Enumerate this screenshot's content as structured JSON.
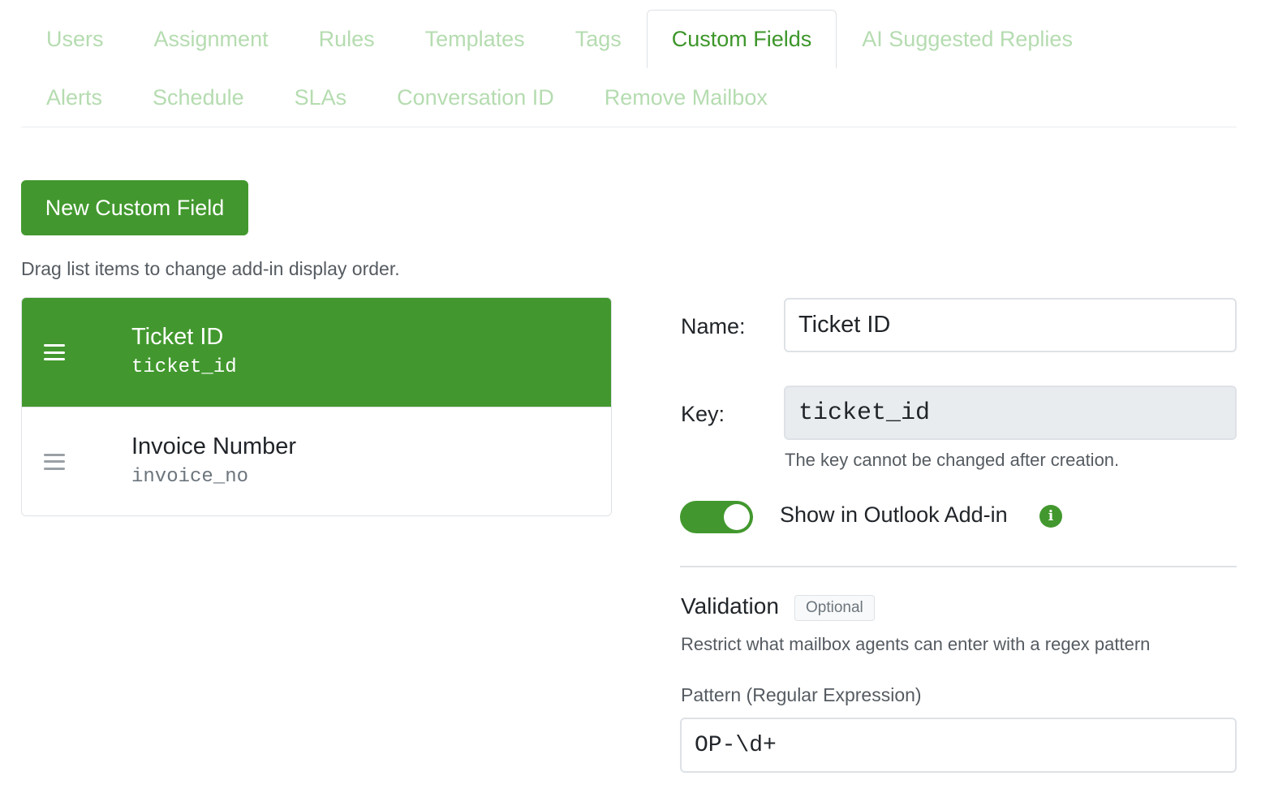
{
  "tabs": {
    "row1": [
      {
        "label": "Users",
        "active": false
      },
      {
        "label": "Assignment",
        "active": false
      },
      {
        "label": "Rules",
        "active": false
      },
      {
        "label": "Templates",
        "active": false
      },
      {
        "label": "Tags",
        "active": false
      },
      {
        "label": "Custom Fields",
        "active": true
      },
      {
        "label": "AI Suggested Replies",
        "active": false
      }
    ],
    "row2": [
      {
        "label": "Alerts",
        "active": false
      },
      {
        "label": "Schedule",
        "active": false
      },
      {
        "label": "SLAs",
        "active": false
      },
      {
        "label": "Conversation ID",
        "active": false
      },
      {
        "label": "Remove Mailbox",
        "active": false
      }
    ]
  },
  "actions": {
    "new_field_label": "New Custom Field"
  },
  "list": {
    "hint": "Drag list items to change add-in display order.",
    "items": [
      {
        "name": "Ticket ID",
        "key": "ticket_id",
        "selected": true
      },
      {
        "name": "Invoice Number",
        "key": "invoice_no",
        "selected": false
      }
    ]
  },
  "form": {
    "name_label": "Name:",
    "name_value": "Ticket ID",
    "key_label": "Key:",
    "key_value": "ticket_id",
    "key_help": "The key cannot be changed after creation.",
    "toggle_label": "Show in Outlook Add-in",
    "toggle_on": true,
    "info_icon": "i",
    "validation_title": "Validation",
    "validation_badge": "Optional",
    "validation_desc": "Restrict what mailbox agents can enter with a regex pattern",
    "pattern_label": "Pattern (Regular Expression)",
    "pattern_value": "OP-\\d+"
  },
  "colors": {
    "accent": "#42982e",
    "tab_inactive": "#b5dcb0",
    "tab_active": "#3d962a"
  }
}
